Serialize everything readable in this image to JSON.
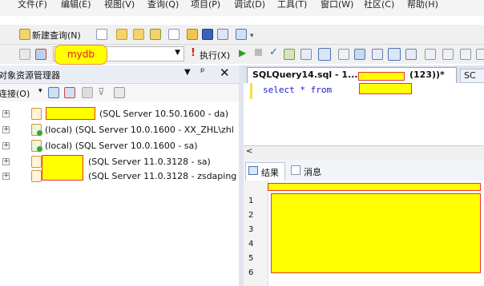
{
  "menubar": {
    "items": [
      "文件(F)",
      "编辑(E)",
      "视图(V)",
      "查询(Q)",
      "项目(P)",
      "调试(D)",
      "工具(T)",
      "窗口(W)",
      "社区(C)",
      "帮助(H)"
    ]
  },
  "toolbar": {
    "new_query_label": "新建查询(N)"
  },
  "sql_toolbar": {
    "database": "mydb",
    "execute_label": "执行(X)"
  },
  "object_explorer": {
    "title": "对象资源管理器",
    "connect_label": "连接(O)",
    "servers": [
      {
        "label": "(SQL Server 10.50.1600 - da)"
      },
      {
        "label": "(local) (SQL Server 10.0.1600 - XX_ZHL\\zhl"
      },
      {
        "label": "(local) (SQL Server 10.0.1600 - sa)"
      },
      {
        "label": "(SQL Server 11.0.3128 - sa)"
      },
      {
        "label": "(SQL Server 11.0.3128 - zsdaping"
      }
    ]
  },
  "document": {
    "tab_title": "SQLQuery14.sql - 1...",
    "tab_suffix": "(123))*",
    "second_tab": "SC",
    "query_text": "select * from"
  },
  "results": {
    "tab_results": "结果",
    "tab_messages": "消息",
    "row_numbers": [
      "1",
      "2",
      "3",
      "4",
      "5",
      "6"
    ]
  }
}
